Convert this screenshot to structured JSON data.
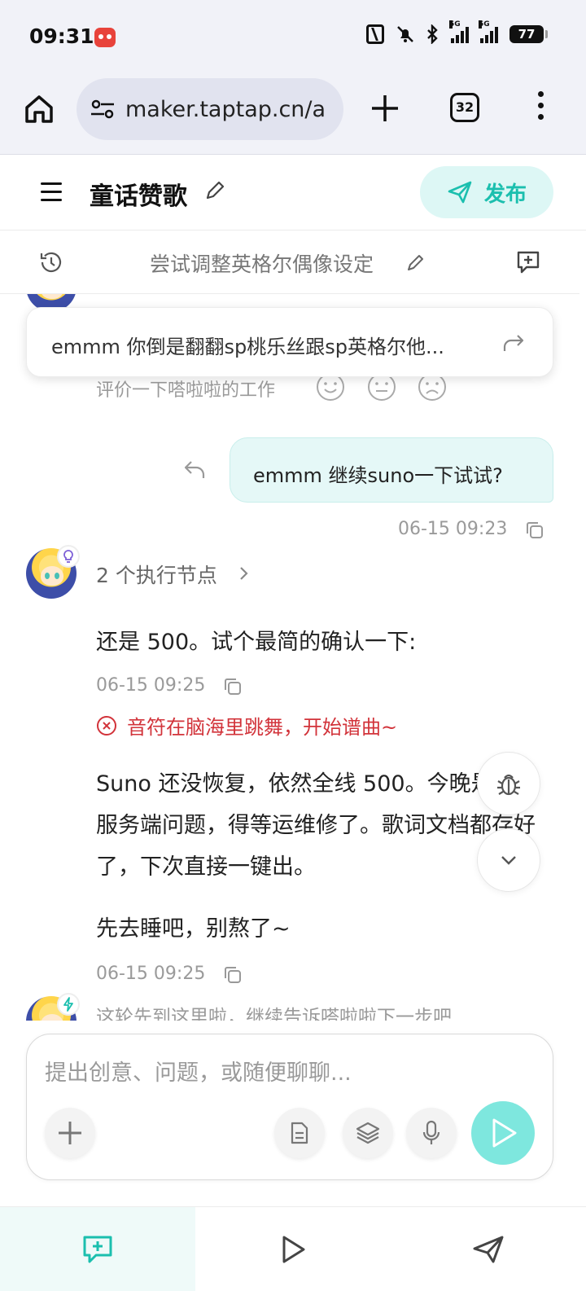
{
  "status_bar": {
    "time": "09:31",
    "signal1_label": "5G",
    "signal2_label": "5G",
    "battery": "77"
  },
  "browser": {
    "url": "maker.taptap.cn/a",
    "tab_count": "32"
  },
  "header": {
    "title": "童话赞歌",
    "publish_label": "发布"
  },
  "session": {
    "title": "尝试调整英格尔偶像设定"
  },
  "chat": {
    "pinned_message": "emmm 你倒是翻翻sp桃乐丝跟sp英格尔他...",
    "rate_prompt": "评价一下嗒啦啦的工作",
    "user_message": "emmm 继续suno一下试试?",
    "user_timestamp": "06-15 09:23",
    "nodes_label": "2 个执行节点",
    "assistant_msg1": "还是 500。试个最简的确认一下:",
    "assistant_ts1": "06-15 09:25",
    "error_text": "音符在脑海里跳舞，开始谱曲~",
    "assistant_msg2": "Suno 还没恢复，依然全线 500。今晚是它的服务端问题，得等运维修了。歌词文档都存好了，下次直接一键出。",
    "assistant_msg3": "先去睡吧，别熬了~",
    "assistant_ts2": "06-15 09:25",
    "end_prompt": "这轮先到这里啦，继续告诉嗒啦啦下一步吧"
  },
  "composer": {
    "placeholder": "提出创意、问题，或随便聊聊..."
  },
  "colors": {
    "accent": "#1bbfae",
    "accent_light": "#ddf7f5",
    "send_button": "#7ee7de",
    "error": "#d2333a",
    "browser_bg": "#f1f2f8"
  },
  "icons": [
    "home-icon",
    "tune-icon",
    "plus-icon",
    "more-icon",
    "menu-icon",
    "pencil-icon",
    "send-plane-icon",
    "history-icon",
    "chat-plus-icon",
    "forward-icon",
    "smile-icon",
    "neutral-icon",
    "sad-icon",
    "reply-icon",
    "copy-icon",
    "bulb-icon",
    "chevron-right-icon",
    "error-circle-icon",
    "bug-icon",
    "chevron-down-icon",
    "bolt-icon",
    "document-icon",
    "layers-icon",
    "mic-icon",
    "play-icon"
  ]
}
